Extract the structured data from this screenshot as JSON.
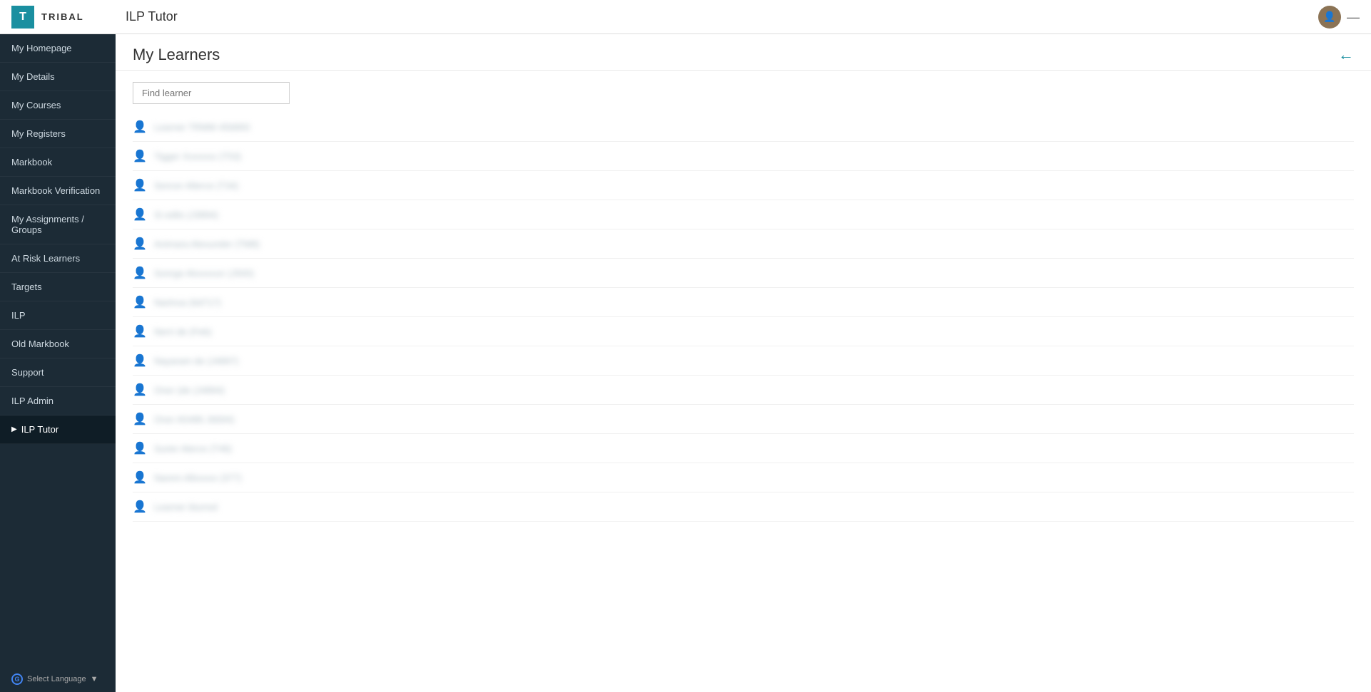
{
  "header": {
    "logo_letter": "T",
    "logo_text": "TRIBAL",
    "app_title": "ILP Tutor",
    "minimize_symbol": "—"
  },
  "sidebar": {
    "items": [
      {
        "label": "My Homepage",
        "active": false
      },
      {
        "label": "My Details",
        "active": false
      },
      {
        "label": "My Courses",
        "active": false
      },
      {
        "label": "My Registers",
        "active": false
      },
      {
        "label": "Markbook",
        "active": false
      },
      {
        "label": "Markbook Verification",
        "active": false
      },
      {
        "label": "My Assignments / Groups",
        "active": false
      },
      {
        "label": "At Risk Learners",
        "active": false
      },
      {
        "label": "Targets",
        "active": false
      },
      {
        "label": "ILP",
        "active": false
      },
      {
        "label": "Old Markbook",
        "active": false
      },
      {
        "label": "Support",
        "active": false
      },
      {
        "label": "ILP Admin",
        "active": false
      },
      {
        "label": "ILP Tutor",
        "active": true
      }
    ],
    "select_language": "Select Language"
  },
  "content": {
    "page_title": "My Learners",
    "back_arrow": "←",
    "search_placeholder": "Find learner",
    "learners": [
      {
        "name": "Learner TRMM 456893"
      },
      {
        "name": "Tigger Xxxxxxx (T53)"
      },
      {
        "name": "Sencer Allerce (T34)"
      },
      {
        "name": "Si edits (J3894)"
      },
      {
        "name": "Animara Alexunder (TM8)"
      },
      {
        "name": "Sonrge Alxxxxxxr (J500)"
      },
      {
        "name": "Nartnxa (6d717)"
      },
      {
        "name": "Nerri de (Feb)"
      },
      {
        "name": "Nayaram de (J4897)"
      },
      {
        "name": "Oner (de (J4894)"
      },
      {
        "name": "Oner A5486 J6694)"
      },
      {
        "name": "Surier Alerce (T46)"
      },
      {
        "name": "Narem Allxxxxx (377)"
      },
      {
        "name": "Learner blurred"
      }
    ]
  }
}
